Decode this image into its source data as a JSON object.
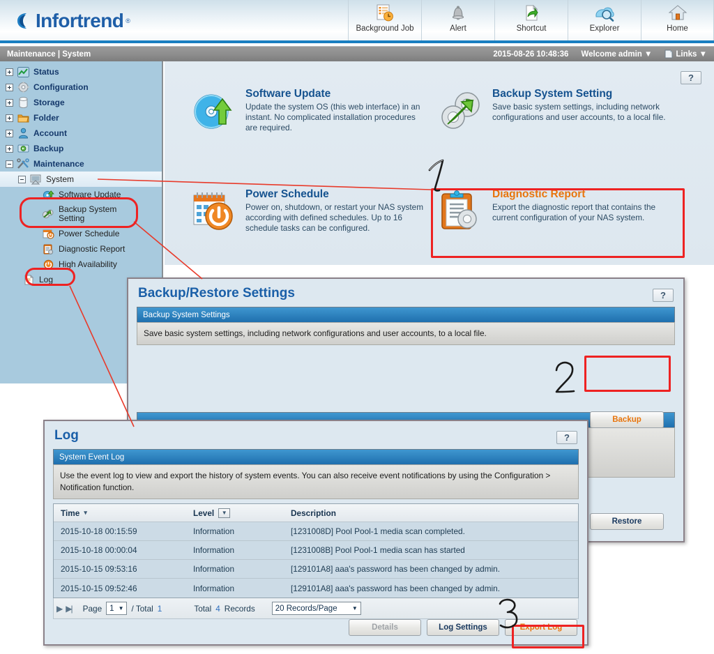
{
  "brand": {
    "name": "Infortrend",
    "tm": "®"
  },
  "toolbar": {
    "items": [
      {
        "label": "Background Job",
        "icon": "background-job-icon"
      },
      {
        "label": "Alert",
        "icon": "alert-icon"
      },
      {
        "label": "Shortcut",
        "icon": "shortcut-icon"
      },
      {
        "label": "Explorer",
        "icon": "explorer-icon"
      },
      {
        "label": "Home",
        "icon": "home-icon"
      }
    ]
  },
  "crumbbar": {
    "breadcrumb": "Maintenance | System",
    "datetime": "2015-08-26 10:48:36",
    "welcome": "Welcome admin ▼",
    "links": "Links ▼"
  },
  "sidebar": {
    "items": [
      {
        "label": "Status",
        "level": 1,
        "expander": "plus",
        "icon": "status-icon"
      },
      {
        "label": "Configuration",
        "level": 1,
        "expander": "plus",
        "icon": "configuration-icon"
      },
      {
        "label": "Storage",
        "level": 1,
        "expander": "plus",
        "icon": "storage-icon"
      },
      {
        "label": "Folder",
        "level": 1,
        "expander": "plus",
        "icon": "folder-icon"
      },
      {
        "label": "Account",
        "level": 1,
        "expander": "plus",
        "icon": "account-icon"
      },
      {
        "label": "Backup",
        "level": 1,
        "expander": "plus",
        "icon": "backup-icon"
      },
      {
        "label": "Maintenance",
        "level": 1,
        "expander": "minus",
        "icon": "maintenance-icon"
      },
      {
        "label": "System",
        "level": 2,
        "expander": "minus",
        "icon": "system-icon"
      },
      {
        "label": "Software Update",
        "level": 3,
        "expander": "none",
        "icon": "software-update-icon"
      },
      {
        "label": "Backup System Setting",
        "level": 3,
        "expander": "none",
        "icon": "backup-system-setting-icon"
      },
      {
        "label": "Power Schedule",
        "level": 3,
        "expander": "none",
        "icon": "power-schedule-icon"
      },
      {
        "label": "Diagnostic Report",
        "level": 3,
        "expander": "none",
        "icon": "diagnostic-report-icon"
      },
      {
        "label": "High Availability",
        "level": 3,
        "expander": "none",
        "icon": "high-availability-icon"
      },
      {
        "label": "Log",
        "level": 2,
        "expander": "none",
        "icon": "log-icon"
      }
    ]
  },
  "main": {
    "help_label": "?",
    "features": [
      {
        "title": "Software Update",
        "desc": "Update the system OS (this web interface) in an instant. No complicated installation procedures are required.",
        "icon": "software-update-disc-icon",
        "accent": "blue"
      },
      {
        "title": "Backup System Setting",
        "desc": "Save basic system settings, including network configurations and user accounts, to a local file.",
        "icon": "gears-arrow-icon",
        "accent": "blue"
      },
      {
        "title": "Power Schedule",
        "desc": "Power on, shutdown, or restart your NAS system according with defined schedules. Up to 16 schedule tasks can be configured.",
        "icon": "calendar-power-icon",
        "accent": "blue"
      },
      {
        "title": "Diagnostic Report",
        "desc": "Export the diagnostic report that contains the current configuration of your NAS system.",
        "icon": "clipboard-gear-icon",
        "accent": "orange"
      }
    ]
  },
  "backup_dialog": {
    "title": "Backup/Restore Settings",
    "help_label": "?",
    "section_title": "Backup System Settings",
    "section_desc": "Save basic system settings, including network configurations and user accounts, to a local file.",
    "backup_button": "Backup",
    "restore_button": "Restore"
  },
  "log_dialog": {
    "title": "Log",
    "help_label": "?",
    "section_title": "System Event Log",
    "section_desc": "Use the event log to view and export the history of system events. You can also receive event notifications by using the Configuration > Notification function.",
    "columns": [
      "Time",
      "Level",
      "Description"
    ],
    "rows": [
      {
        "time": "2015-10-18 00:15:59",
        "level": "Information",
        "description": "[1231008D] Pool Pool-1 media scan completed."
      },
      {
        "time": "2015-10-18 00:00:04",
        "level": "Information",
        "description": "[1231008B] Pool Pool-1 media scan has started"
      },
      {
        "time": "2015-10-15 09:53:16",
        "level": "Information",
        "description": "[129101A8] aaa's password has been changed by admin."
      },
      {
        "time": "2015-10-15 09:52:46",
        "level": "Information",
        "description": "[129101A8] aaa's password has been changed by admin."
      }
    ],
    "pager": {
      "page_label": "Page",
      "page_value": "1",
      "slash_total_label": "/ Total",
      "total_pages": "1",
      "total_label": "Total",
      "record_count": "4",
      "records_label": "Records",
      "records_per_page": "20 Records/Page"
    },
    "buttons": {
      "details": "Details",
      "log_settings": "Log Settings",
      "export_log": "Export Log"
    }
  },
  "annotations": {
    "numbers": [
      "1",
      "2",
      "3"
    ],
    "highlight_color": "#ee2222"
  }
}
